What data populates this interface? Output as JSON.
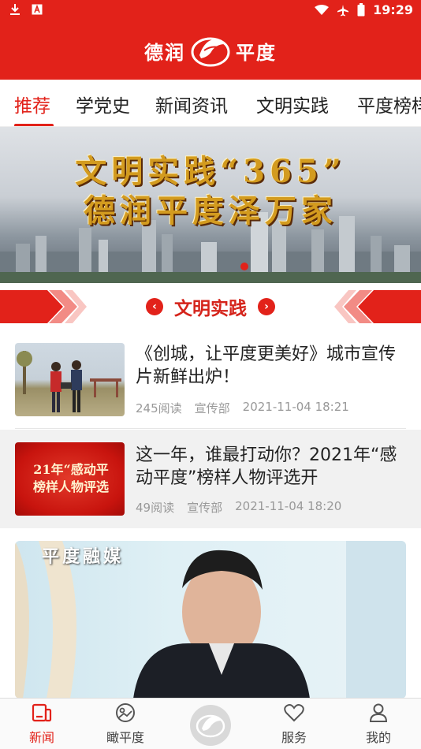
{
  "status_bar": {
    "time": "19:29"
  },
  "header": {
    "app_title_left": "德润",
    "app_title_right": "平度"
  },
  "tabs": [
    {
      "label": "推荐",
      "active": true
    },
    {
      "label": "学党史",
      "active": false
    },
    {
      "label": "新闻资讯",
      "active": false
    },
    {
      "label": "文明实践",
      "active": false
    },
    {
      "label": "平度榜样",
      "active": false
    }
  ],
  "banner": {
    "line1": "文明实践“365”",
    "line2": "德润平度泽万家",
    "page_index": 1
  },
  "section": {
    "title": "文明实践"
  },
  "news": [
    {
      "title": "《创城，让平度更美好》城市宣传片新鲜出炉！",
      "reads": "245阅读",
      "source": "宣传部",
      "time": "2021-11-04 18:21"
    },
    {
      "title": "这一年，谁最打动你？2021年“感动平度”榜样人物评选开",
      "reads": "49阅读",
      "source": "宣传部",
      "time": "2021-11-04 18:20",
      "thumb_text_1": "21年“感动平",
      "thumb_text_2": "榜样人物评选"
    }
  ],
  "video": {
    "watermark": "平度融媒"
  },
  "bottom_nav": [
    {
      "label": "新闻",
      "icon": "news-icon",
      "active": true
    },
    {
      "label": "瞰平度",
      "icon": "explore-icon",
      "active": false
    },
    {
      "label": "",
      "icon": "logo-hand-icon",
      "active": false
    },
    {
      "label": "服务",
      "icon": "heart-service-icon",
      "active": false
    },
    {
      "label": "我的",
      "icon": "user-icon",
      "active": false
    }
  ],
  "colors": {
    "brand_red": "#e2221a",
    "text": "#222222",
    "meta": "#999999"
  }
}
